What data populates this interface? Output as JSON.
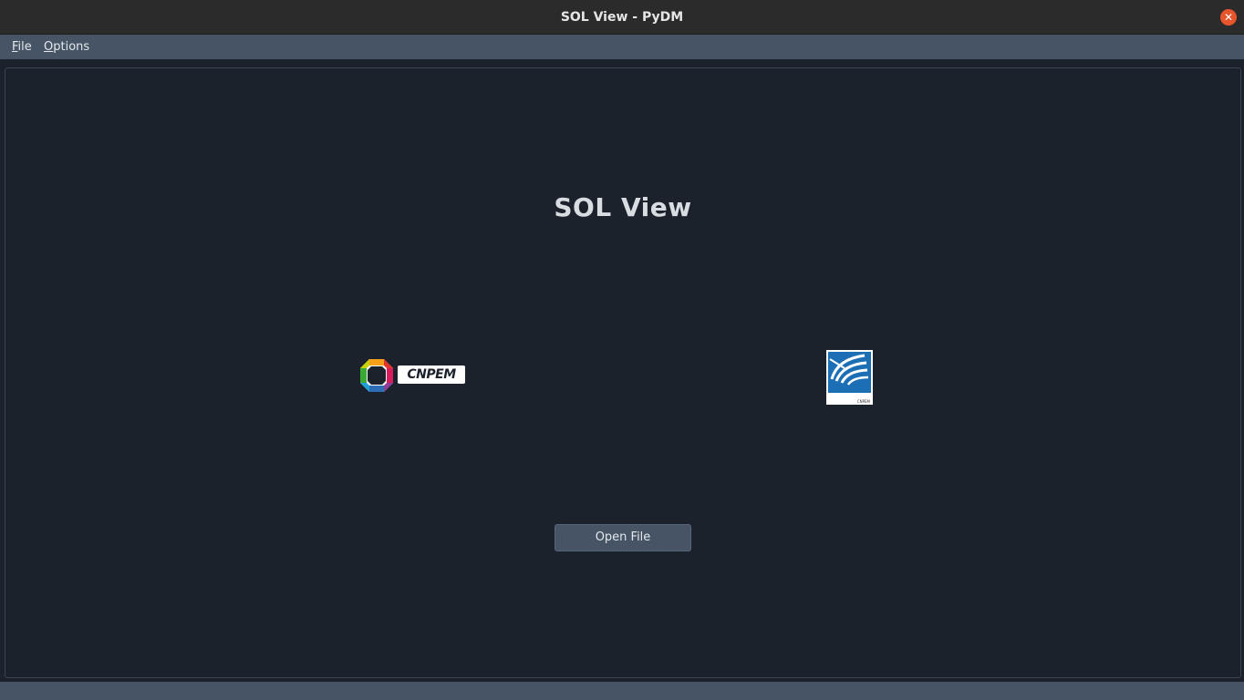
{
  "window": {
    "title": "SOL View - PyDM",
    "close_glyph": "✕"
  },
  "menubar": {
    "items": [
      {
        "mnemonic": "F",
        "rest": "ile"
      },
      {
        "mnemonic": "O",
        "rest": "ptions"
      }
    ]
  },
  "main": {
    "heading": "SOL View",
    "logos": {
      "left": {
        "text": "CNPEM",
        "icon": "cnpem-logo-icon"
      },
      "right": {
        "text": "LNLS",
        "small": "CNPEM",
        "icon": "lnls-logo-icon",
        "color": "#1c6fb5"
      }
    },
    "open_file_label": "Open File"
  },
  "colors": {
    "background": "#1b222c",
    "menubar": "#465465",
    "titlebar": "#2b2b2b",
    "close": "#e8542b"
  }
}
